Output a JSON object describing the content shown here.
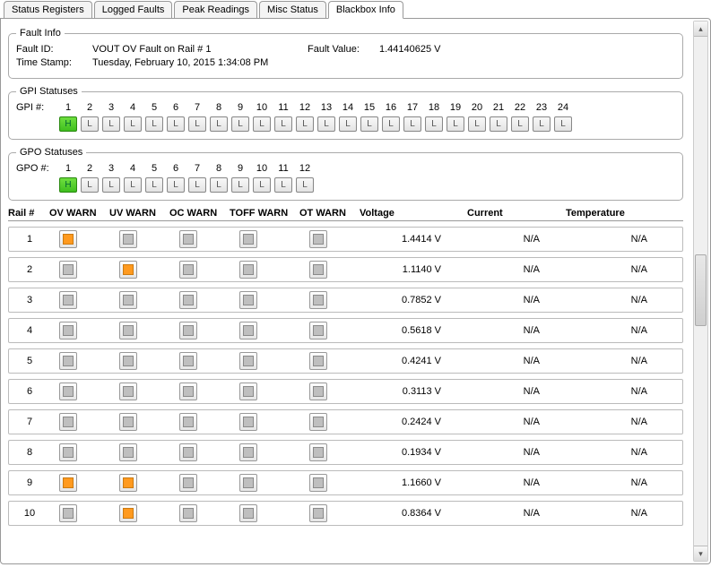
{
  "tabs": {
    "items": [
      {
        "label": "Status Registers"
      },
      {
        "label": "Logged Faults"
      },
      {
        "label": "Peak Readings"
      },
      {
        "label": "Misc Status"
      },
      {
        "label": "Blackbox Info"
      }
    ],
    "active": 4
  },
  "fault_info": {
    "legend": "Fault Info",
    "fault_id_label": "Fault ID:",
    "fault_id": "VOUT OV Fault on Rail # 1",
    "fault_value_label": "Fault Value:",
    "fault_value": "1.44140625 V",
    "timestamp_label": "Time Stamp:",
    "timestamp": "Tuesday, February 10, 2015 1:34:08 PM"
  },
  "gpi": {
    "legend": "GPI Statuses",
    "label": "GPI #:",
    "items": [
      {
        "n": "1",
        "v": "H"
      },
      {
        "n": "2",
        "v": "L"
      },
      {
        "n": "3",
        "v": "L"
      },
      {
        "n": "4",
        "v": "L"
      },
      {
        "n": "5",
        "v": "L"
      },
      {
        "n": "6",
        "v": "L"
      },
      {
        "n": "7",
        "v": "L"
      },
      {
        "n": "8",
        "v": "L"
      },
      {
        "n": "9",
        "v": "L"
      },
      {
        "n": "10",
        "v": "L"
      },
      {
        "n": "11",
        "v": "L"
      },
      {
        "n": "12",
        "v": "L"
      },
      {
        "n": "13",
        "v": "L"
      },
      {
        "n": "14",
        "v": "L"
      },
      {
        "n": "15",
        "v": "L"
      },
      {
        "n": "16",
        "v": "L"
      },
      {
        "n": "17",
        "v": "L"
      },
      {
        "n": "18",
        "v": "L"
      },
      {
        "n": "19",
        "v": "L"
      },
      {
        "n": "20",
        "v": "L"
      },
      {
        "n": "21",
        "v": "L"
      },
      {
        "n": "22",
        "v": "L"
      },
      {
        "n": "23",
        "v": "L"
      },
      {
        "n": "24",
        "v": "L"
      }
    ]
  },
  "gpo": {
    "legend": "GPO Statuses",
    "label": "GPO #:",
    "items": [
      {
        "n": "1",
        "v": "H"
      },
      {
        "n": "2",
        "v": "L"
      },
      {
        "n": "3",
        "v": "L"
      },
      {
        "n": "4",
        "v": "L"
      },
      {
        "n": "5",
        "v": "L"
      },
      {
        "n": "6",
        "v": "L"
      },
      {
        "n": "7",
        "v": "L"
      },
      {
        "n": "8",
        "v": "L"
      },
      {
        "n": "9",
        "v": "L"
      },
      {
        "n": "10",
        "v": "L"
      },
      {
        "n": "11",
        "v": "L"
      },
      {
        "n": "12",
        "v": "L"
      }
    ]
  },
  "table": {
    "headers": {
      "rail": "Rail #",
      "ov": "OV WARN",
      "uv": "UV WARN",
      "oc": "OC WARN",
      "toff": "TOFF WARN",
      "ot": "OT WARN",
      "voltage": "Voltage",
      "current": "Current",
      "temperature": "Temperature"
    },
    "rows": [
      {
        "rail": "1",
        "ov": true,
        "uv": false,
        "oc": false,
        "toff": false,
        "ot": false,
        "voltage": "1.4414 V",
        "current": "N/A",
        "temp": "N/A"
      },
      {
        "rail": "2",
        "ov": false,
        "uv": true,
        "oc": false,
        "toff": false,
        "ot": false,
        "voltage": "1.1140 V",
        "current": "N/A",
        "temp": "N/A"
      },
      {
        "rail": "3",
        "ov": false,
        "uv": false,
        "oc": false,
        "toff": false,
        "ot": false,
        "voltage": "0.7852 V",
        "current": "N/A",
        "temp": "N/A"
      },
      {
        "rail": "4",
        "ov": false,
        "uv": false,
        "oc": false,
        "toff": false,
        "ot": false,
        "voltage": "0.5618 V",
        "current": "N/A",
        "temp": "N/A"
      },
      {
        "rail": "5",
        "ov": false,
        "uv": false,
        "oc": false,
        "toff": false,
        "ot": false,
        "voltage": "0.4241 V",
        "current": "N/A",
        "temp": "N/A"
      },
      {
        "rail": "6",
        "ov": false,
        "uv": false,
        "oc": false,
        "toff": false,
        "ot": false,
        "voltage": "0.3113 V",
        "current": "N/A",
        "temp": "N/A"
      },
      {
        "rail": "7",
        "ov": false,
        "uv": false,
        "oc": false,
        "toff": false,
        "ot": false,
        "voltage": "0.2424 V",
        "current": "N/A",
        "temp": "N/A"
      },
      {
        "rail": "8",
        "ov": false,
        "uv": false,
        "oc": false,
        "toff": false,
        "ot": false,
        "voltage": "0.1934 V",
        "current": "N/A",
        "temp": "N/A"
      },
      {
        "rail": "9",
        "ov": true,
        "uv": true,
        "oc": false,
        "toff": false,
        "ot": false,
        "voltage": "1.1660 V",
        "current": "N/A",
        "temp": "N/A"
      },
      {
        "rail": "10",
        "ov": false,
        "uv": true,
        "oc": false,
        "toff": false,
        "ot": false,
        "voltage": "0.8364 V",
        "current": "N/A",
        "temp": "N/A"
      }
    ]
  }
}
